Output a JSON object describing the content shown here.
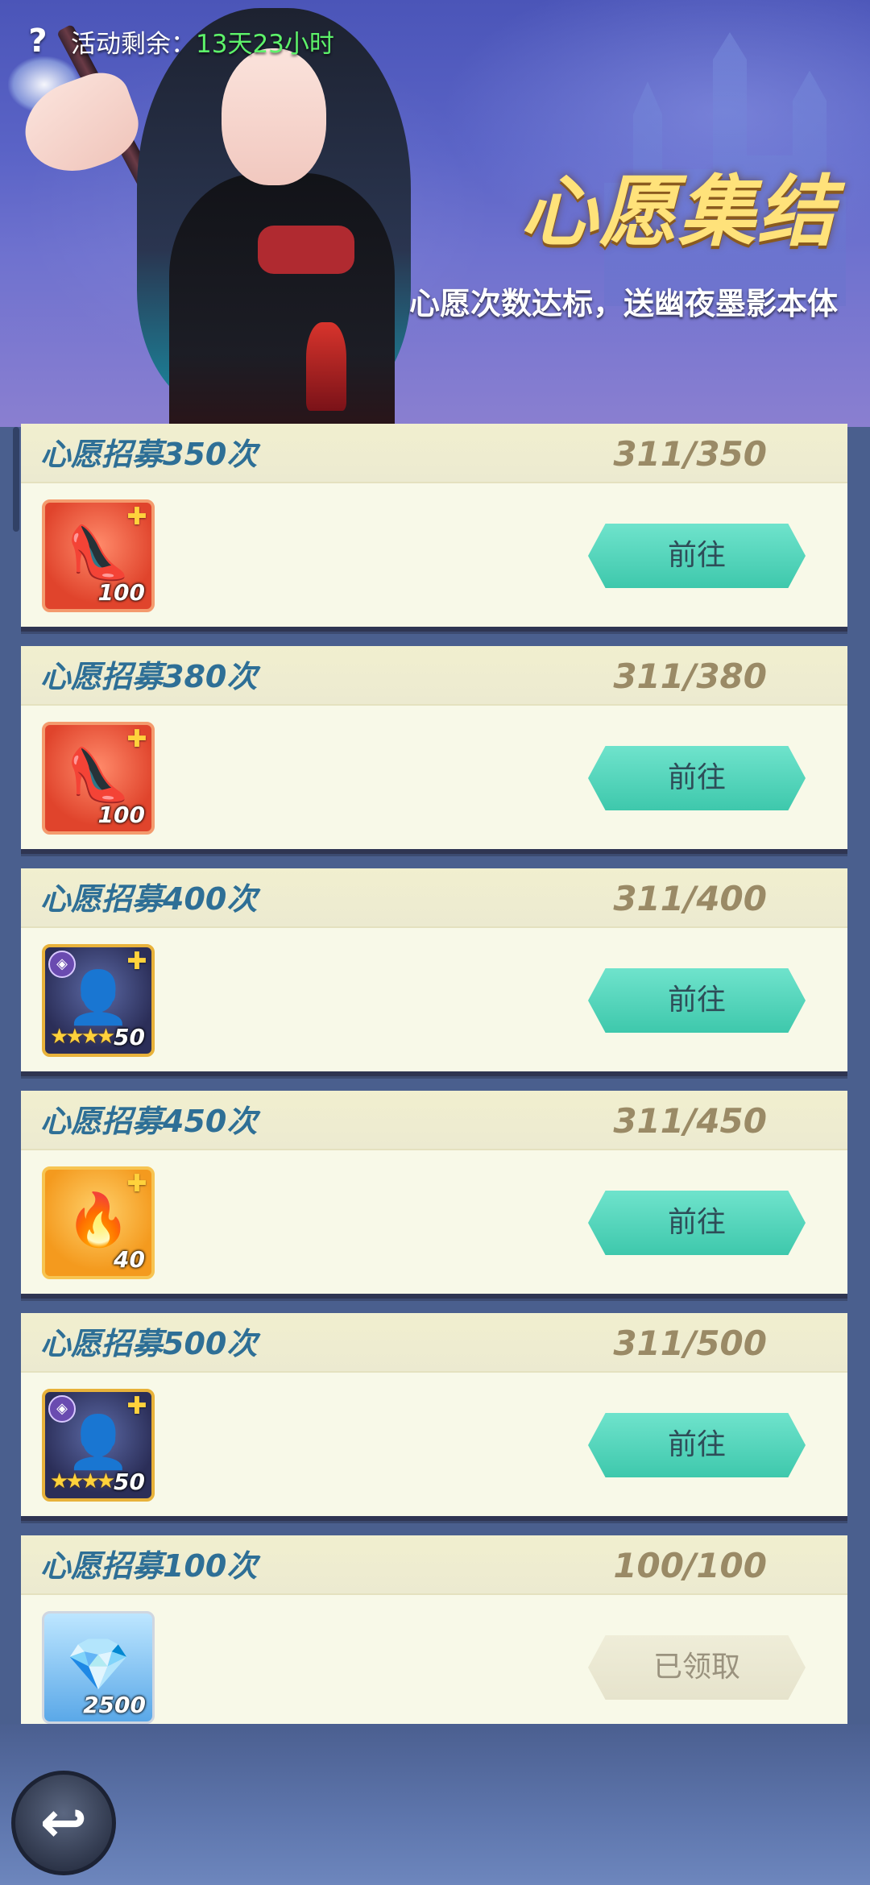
{
  "header": {
    "timer_label": "活动剩余：",
    "timer_value": "13天23小时",
    "title": "心愿集结",
    "subtitle": "心愿次数达标，送幽夜墨影本体"
  },
  "icons": {
    "help": "question-icon",
    "back": "back-arrow-icon",
    "fragment": "puzzle-piece-icon"
  },
  "colors": {
    "title": "#ffe27a",
    "timer_value": "#5df26a",
    "task_title": "#2e6f96",
    "progress": "#9a8a66",
    "go_button": "#4fd3b8"
  },
  "tasks": [
    {
      "title": "心愿招募350次",
      "progress": "311/350",
      "reward_qty": "100",
      "reward_type": "red-shoes",
      "button": "前往",
      "state": "go"
    },
    {
      "title": "心愿招募380次",
      "progress": "311/380",
      "reward_qty": "100",
      "reward_type": "red-shoes",
      "button": "前往",
      "state": "go"
    },
    {
      "title": "心愿招募400次",
      "progress": "311/400",
      "reward_qty": "50",
      "reward_type": "hero-fragment",
      "button": "前往",
      "state": "go"
    },
    {
      "title": "心愿招募450次",
      "progress": "311/450",
      "reward_qty": "40",
      "reward_type": "red-artifact",
      "button": "前往",
      "state": "go"
    },
    {
      "title": "心愿招募500次",
      "progress": "311/500",
      "reward_qty": "50",
      "reward_type": "hero-fragment",
      "button": "前往",
      "state": "go"
    },
    {
      "title": "心愿招募100次",
      "progress": "100/100",
      "reward_qty": "2500",
      "reward_type": "diamond",
      "button": "已领取",
      "state": "claimed"
    }
  ]
}
